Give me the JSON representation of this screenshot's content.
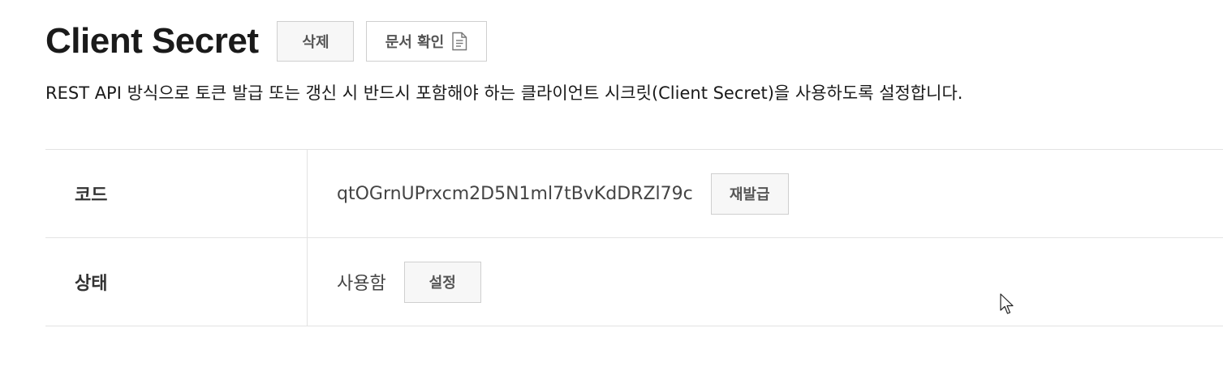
{
  "header": {
    "title": "Client Secret",
    "delete_label": "삭제",
    "docs_label": "문서 확인"
  },
  "description": "REST API 방식으로 토큰 발급 또는 갱신 시 반드시 포함해야 하는 클라이언트 시크릿(Client Secret)을 사용하도록 설정합니다.",
  "table": {
    "code": {
      "label": "코드",
      "value": "qtOGrnUPrxcm2D5N1ml7tBvKdDRZl79c",
      "action_label": "재발급"
    },
    "status": {
      "label": "상태",
      "value": "사용함",
      "action_label": "설정"
    }
  },
  "icons": {
    "docs": "document-icon",
    "cursor": "mouse-pointer-icon"
  }
}
